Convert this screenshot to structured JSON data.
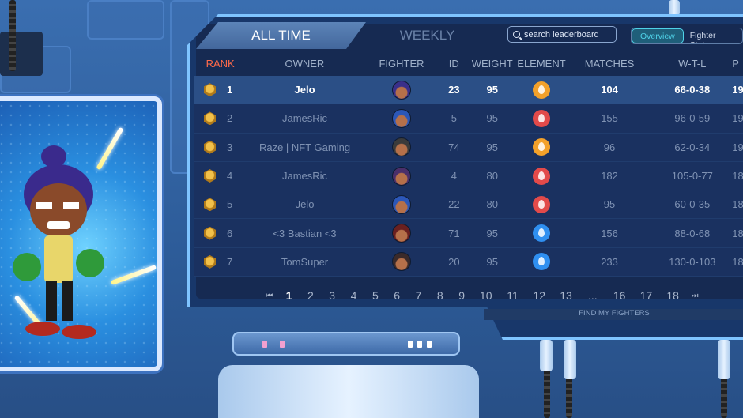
{
  "tabs": {
    "all_time": "ALL TIME",
    "weekly": "WEEKLY"
  },
  "search": {
    "placeholder": "search leaderboard"
  },
  "view_toggle": {
    "overview": "Overview",
    "fighter_stats": "Fighter Stats"
  },
  "columns": {
    "rank": "RANK",
    "owner": "OWNER",
    "fighter": "FIGHTER",
    "id": "ID",
    "weight": "WEIGHT",
    "element": "ELEMENT",
    "matches": "MATCHES",
    "wtl": "W-T-L",
    "last": "P"
  },
  "rows": [
    {
      "rank": "1",
      "owner": "Jelo",
      "id": "23",
      "weight": "95",
      "element": "electric",
      "element_color": "#f3a12a",
      "matches": "104",
      "wtl": "66-0-38",
      "last": "19",
      "avatar_color": "#3a2f8a"
    },
    {
      "rank": "2",
      "owner": "JamesRic",
      "id": "5",
      "weight": "95",
      "element": "fire",
      "element_color": "#e24a4a",
      "matches": "155",
      "wtl": "96-0-59",
      "last": "19",
      "avatar_color": "#2c57b8"
    },
    {
      "rank": "3",
      "owner": "Raze | NFT Gaming",
      "id": "74",
      "weight": "95",
      "element": "electric",
      "element_color": "#f3a12a",
      "matches": "96",
      "wtl": "62-0-34",
      "last": "19",
      "avatar_color": "#3b3b3b"
    },
    {
      "rank": "4",
      "owner": "JamesRic",
      "id": "4",
      "weight": "80",
      "element": "fire",
      "element_color": "#e24a4a",
      "matches": "182",
      "wtl": "105-0-77",
      "last": "18",
      "avatar_color": "#4a2f6a"
    },
    {
      "rank": "5",
      "owner": "Jelo",
      "id": "22",
      "weight": "80",
      "element": "fire",
      "element_color": "#e24a4a",
      "matches": "95",
      "wtl": "60-0-35",
      "last": "18",
      "avatar_color": "#2c57b8"
    },
    {
      "rank": "6",
      "owner": "<3 Bastian <3",
      "id": "71",
      "weight": "95",
      "element": "water",
      "element_color": "#2f8ff0",
      "matches": "156",
      "wtl": "88-0-68",
      "last": "18",
      "avatar_color": "#6a2020"
    },
    {
      "rank": "7",
      "owner": "TomSuper",
      "id": "20",
      "weight": "95",
      "element": "water",
      "element_color": "#2f8ff0",
      "matches": "233",
      "wtl": "130-0-103",
      "last": "18",
      "avatar_color": "#3a2a2a"
    }
  ],
  "pagination": {
    "pages": [
      "1",
      "2",
      "3",
      "4",
      "5",
      "6",
      "7",
      "8",
      "9",
      "10",
      "11",
      "12",
      "13",
      "...",
      "16",
      "17",
      "18"
    ],
    "current": "1"
  },
  "find_my_fighters": "FIND MY FIGHTERS",
  "colors": {
    "accent": "#4fd2e8",
    "rank_header": "#ff6a4a",
    "frame": "#7fc4ff"
  }
}
